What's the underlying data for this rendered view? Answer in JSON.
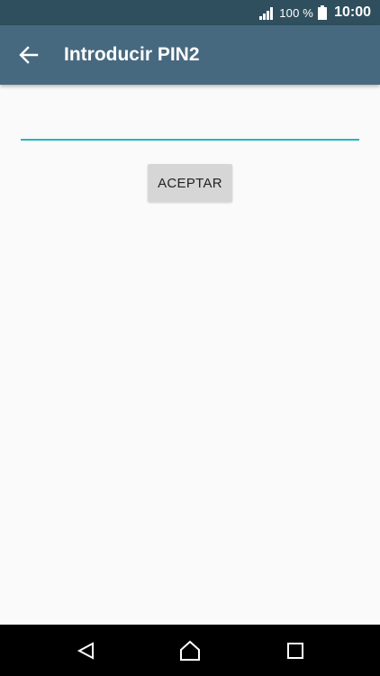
{
  "status_bar": {
    "battery_percent": "100 %",
    "time": "10:00",
    "icons": [
      "signal-icon",
      "battery-icon"
    ]
  },
  "toolbar": {
    "title": "Introducir PIN2",
    "back_icon": "arrow-left-icon"
  },
  "form": {
    "pin_value": "",
    "accept_label": "ACEPTAR"
  },
  "nav_bar": {
    "icons": [
      "back-triangle-icon",
      "home-icon",
      "recents-square-icon"
    ]
  },
  "colors": {
    "status_bar": "#2f4f5e",
    "toolbar": "#47697f",
    "accent": "#26b6c3",
    "background": "#fafafa",
    "button": "#d6d6d6",
    "nav_bar": "#000000"
  }
}
